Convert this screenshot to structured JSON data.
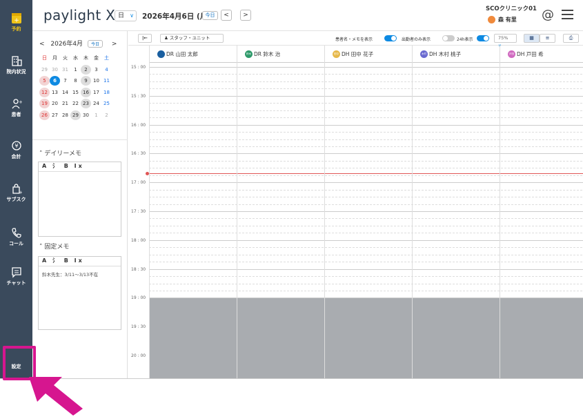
{
  "app": {
    "logo": "paylight X"
  },
  "header": {
    "view_mode": "日",
    "date": "2026年4月6日 (月)",
    "today_label": "今日",
    "prev": "<",
    "next": ">",
    "clinic": "SCOクリニック01",
    "user": "森 有里",
    "at_icon": "@"
  },
  "sidebar": {
    "items": [
      {
        "label": "予約",
        "icon": "calendar-plus-icon"
      },
      {
        "label": "院内状況",
        "icon": "building-icon"
      },
      {
        "label": "患者",
        "icon": "user-add-icon"
      },
      {
        "label": "会計",
        "icon": "yen-icon"
      },
      {
        "label": "サブスク",
        "icon": "bag-plus-icon"
      },
      {
        "label": "コール",
        "icon": "phone-icon"
      },
      {
        "label": "チャット",
        "icon": "chat-icon"
      },
      {
        "label": "設定",
        "icon": "settings-icon"
      }
    ]
  },
  "calendar": {
    "month": "2026年4月",
    "today_label": "今日",
    "prev": "<",
    "next": ">",
    "weekdays": [
      "日",
      "月",
      "火",
      "水",
      "木",
      "金",
      "土"
    ],
    "weeks": [
      [
        "29",
        "30",
        "31",
        "1",
        "2",
        "3",
        "4"
      ],
      [
        "5",
        "6",
        "7",
        "8",
        "9",
        "10",
        "11"
      ],
      [
        "12",
        "13",
        "14",
        "15",
        "16",
        "17",
        "18"
      ],
      [
        "19",
        "20",
        "21",
        "22",
        "23",
        "24",
        "25"
      ],
      [
        "26",
        "27",
        "28",
        "29",
        "30",
        "1",
        "2"
      ]
    ]
  },
  "daily_memo": {
    "title": "デイリーメモ",
    "toolbar": "A 氵 B Ix",
    "text": ""
  },
  "fixed_memo": {
    "title": "固定メモ",
    "toolbar": "A 氵 B Ix",
    "text": "鈴木先生：3/11〜3/13不在"
  },
  "toolbar": {
    "collapse": "|←",
    "staff_unit": "スタッフ・ユニット",
    "show_patient_memo": "患者名・メモを表示",
    "attendees_only": "出勤者のみ表示",
    "h24": "24h表示",
    "zoom": "75%"
  },
  "staff": [
    {
      "name": "DR 山田 太郎",
      "badge": "",
      "color": "#1a5fa0"
    },
    {
      "name": "DR 鈴木 治",
      "badge": "鈴木",
      "color": "#2e9a6a"
    },
    {
      "name": "DH 田中 花子",
      "badge": "田中",
      "color": "#e6b84a"
    },
    {
      "name": "DH 木村 桃子",
      "badge": "木村",
      "color": "#6a6ad0"
    },
    {
      "name": "DH 戸田 希",
      "badge": "戸田",
      "color": "#d06ac0"
    }
  ],
  "times": [
    "15 : 00",
    "15 : 30",
    "16 : 00",
    "16 : 30",
    "17 : 00",
    "17 : 30",
    "18 : 00",
    "18 : 30",
    "19 : 00",
    "19 : 30",
    "20 : 00"
  ]
}
